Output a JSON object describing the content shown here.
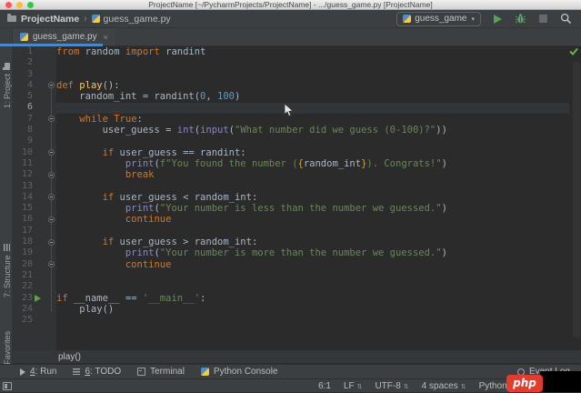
{
  "title_bar": {
    "title": "ProjectName [~/PycharmProjects/ProjectName] - .../guess_game.py [ProjectName]"
  },
  "toolbar": {
    "breadcrumb_project": "ProjectName",
    "breadcrumb_file": "guess_game.py",
    "run_config_label": "guess_game"
  },
  "tab": {
    "label": "guess_game.py"
  },
  "left_strip": {
    "project": "1: Project",
    "structure": "7: Structure",
    "favorites": "2: Favorites"
  },
  "editor": {
    "line_count": 25,
    "current_line": 6,
    "run_line": 23,
    "fold_lines": [
      4,
      7,
      10,
      12,
      14,
      16,
      18,
      20
    ],
    "lines": [
      [
        [
          "k",
          "from"
        ],
        [
          "t",
          " random "
        ],
        [
          "k",
          "import"
        ],
        [
          "t",
          " randint"
        ]
      ],
      [],
      [],
      [
        [
          "k",
          "def "
        ],
        [
          "d",
          "play"
        ],
        [
          "t",
          "():"
        ]
      ],
      [
        [
          "t",
          "    random_int = randint("
        ],
        [
          "n",
          "0"
        ],
        [
          "t",
          ", "
        ],
        [
          "n",
          "100"
        ],
        [
          "t",
          ")"
        ]
      ],
      [],
      [
        [
          "t",
          "    "
        ],
        [
          "k",
          "while "
        ],
        [
          "k",
          "True"
        ],
        [
          "t",
          ":"
        ]
      ],
      [
        [
          "t",
          "        user_guess = "
        ],
        [
          "b",
          "int"
        ],
        [
          "t",
          "("
        ],
        [
          "b",
          "input"
        ],
        [
          "t",
          "("
        ],
        [
          "s",
          "\"What number did we guess (0-100)?\""
        ],
        [
          "t",
          "))"
        ]
      ],
      [],
      [
        [
          "t",
          "        "
        ],
        [
          "k",
          "if"
        ],
        [
          "t",
          " user_guess == randint:"
        ]
      ],
      [
        [
          "t",
          "            "
        ],
        [
          "b",
          "print"
        ],
        [
          "t",
          "("
        ],
        [
          "s",
          "f\"You found the number ("
        ],
        [
          "f",
          "{"
        ],
        [
          "t",
          "random_int"
        ],
        [
          "f",
          "}"
        ],
        [
          "s",
          "). Congrats!\""
        ],
        [
          "t",
          ")"
        ]
      ],
      [
        [
          "t",
          "            "
        ],
        [
          "k",
          "break"
        ]
      ],
      [],
      [
        [
          "t",
          "        "
        ],
        [
          "k",
          "if"
        ],
        [
          "t",
          " user_guess < random_int:"
        ]
      ],
      [
        [
          "t",
          "            "
        ],
        [
          "b",
          "print"
        ],
        [
          "t",
          "("
        ],
        [
          "s",
          "\"Your number is less than the number we guessed.\""
        ],
        [
          "t",
          ")"
        ]
      ],
      [
        [
          "t",
          "            "
        ],
        [
          "k",
          "continue"
        ]
      ],
      [],
      [
        [
          "t",
          "        "
        ],
        [
          "k",
          "if"
        ],
        [
          "t",
          " user_guess > random_int:"
        ]
      ],
      [
        [
          "t",
          "            "
        ],
        [
          "b",
          "print"
        ],
        [
          "t",
          "("
        ],
        [
          "s",
          "\"Your number is more than the number we guessed.\""
        ],
        [
          "t",
          ")"
        ]
      ],
      [
        [
          "t",
          "            "
        ],
        [
          "k",
          "continue"
        ]
      ],
      [],
      [],
      [
        [
          "k",
          "if"
        ],
        [
          "t",
          " __name__ == "
        ],
        [
          "s",
          "'__main__'"
        ],
        [
          "t",
          ":"
        ]
      ],
      [
        [
          "t",
          "    play()"
        ]
      ],
      []
    ]
  },
  "bottom_breadcrumb": {
    "label": "play()"
  },
  "tool_window_bar": {
    "run_mnemonic": "4",
    "run_rest": ": Run",
    "todo_mnemonic": "6",
    "todo_rest": ": TODO",
    "terminal": "Terminal",
    "python_console": "Python Console",
    "event_log": "Event Log"
  },
  "status_bar": {
    "caret": "6:1",
    "line_sep": "LF",
    "encoding": "UTF-8",
    "indent": "4 spaces",
    "interpreter": "Python 3.6 (Proje"
  },
  "watermark": {
    "label": "php"
  },
  "colors": {
    "accent_blue": "#4a88c7",
    "editor_bg": "#2b2b2b",
    "chrome_bg": "#3c3f41",
    "keyword": "#cc7832",
    "string": "#6a8759",
    "number": "#6897bb",
    "builtin": "#8888c6",
    "function": "#ffc66b",
    "run_green": "#5ca65c",
    "traffic_red": "#fc5753",
    "traffic_yellow": "#fdbc40",
    "traffic_green": "#33c748",
    "watermark_red": "#e33b2e"
  }
}
